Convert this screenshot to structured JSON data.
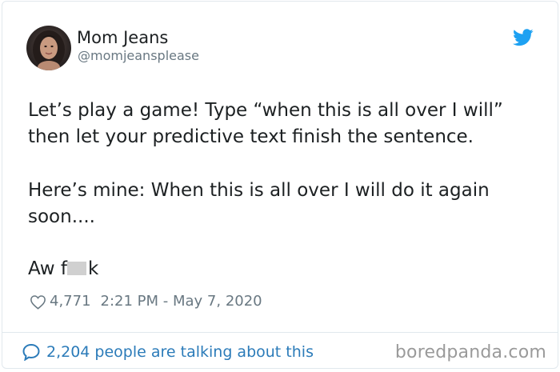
{
  "tweet": {
    "author_name": "Mom Jeans",
    "author_handle": "@momjeansplease",
    "body_line1": "Let’s play a game! Type “when this is all over I will” then let your predictive text finish the sentence.",
    "body_line2": "Here’s mine: When this is all over I will do it again soon....",
    "body_line3_start": "Aw f",
    "body_line3_end": "k",
    "likes": "4,771",
    "timestamp": "2:21 PM - May 7, 2020",
    "talking_text": "2,204 people are talking about this"
  },
  "watermark": "boredpanda.com",
  "icons": {
    "brand": "twitter-bird-icon",
    "like": "heart-icon",
    "reply": "speech-bubble-icon"
  },
  "colors": {
    "twitter_blue": "#1da1f2",
    "link_blue": "#2b7bb9",
    "secondary_text": "#697882",
    "border": "#e1e8ed"
  }
}
